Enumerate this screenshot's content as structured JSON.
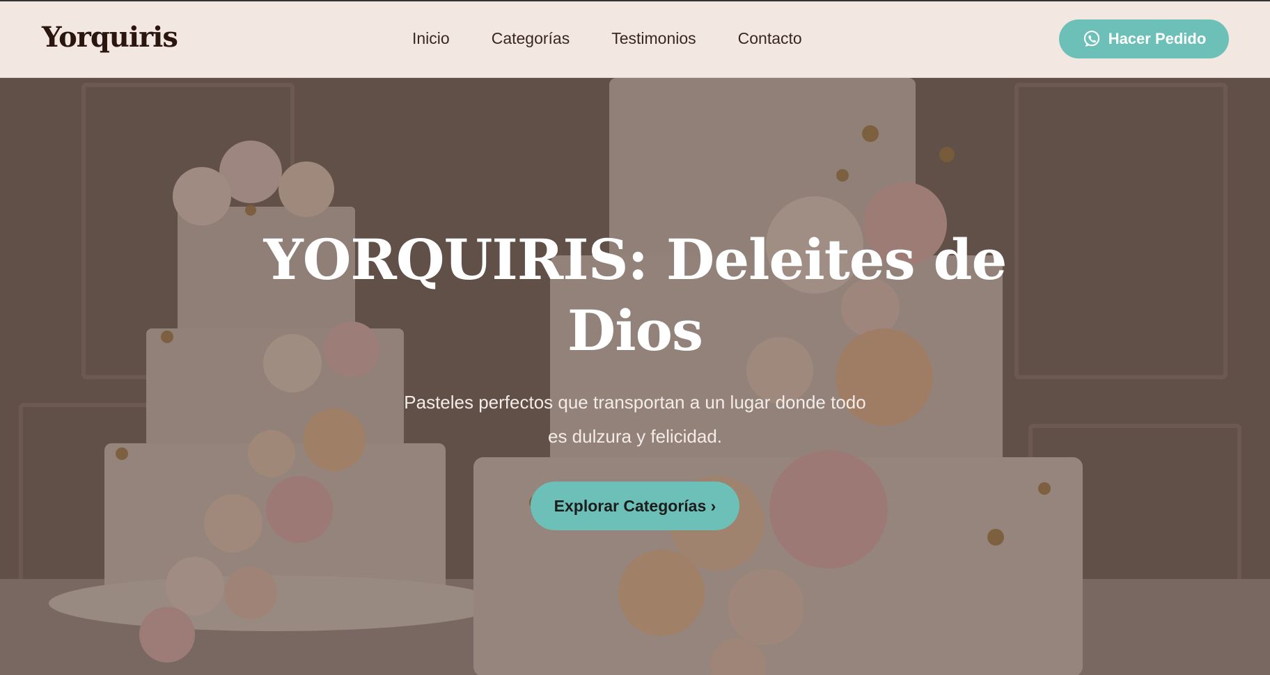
{
  "header": {
    "logo": "Yorquiris",
    "nav": [
      {
        "label": "Inicio"
      },
      {
        "label": "Categorías"
      },
      {
        "label": "Testimonios"
      },
      {
        "label": "Contacto"
      }
    ],
    "order_button": {
      "label": "Hacer Pedido",
      "icon": "whatsapp-icon"
    }
  },
  "hero": {
    "title": "YORQUIRIS: Deleites de Dios",
    "subtitle": "Pasteles perfectos que transportan a un lugar donde todo es dulzura y felicidad.",
    "cta_label": "Explorar Categorías ›",
    "background_image": "wedding-cakes-with-roses"
  },
  "colors": {
    "accent": "#6cc0b7",
    "navbar_bg": "#f2e7e1",
    "logo_text": "#2a160f",
    "nav_text": "#3a2620"
  }
}
